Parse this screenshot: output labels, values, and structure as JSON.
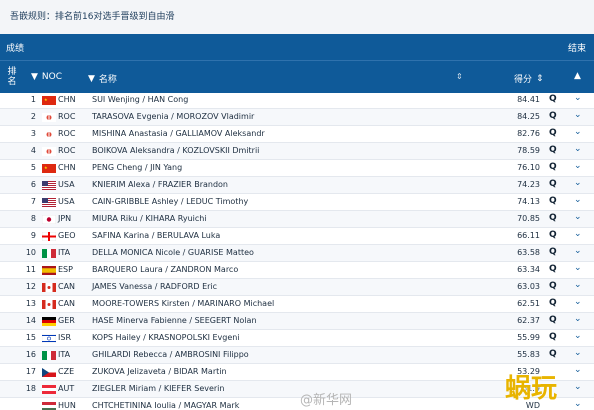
{
  "note": "吾嵌规则：排名前16对选手晋级到自由滑",
  "panel": {
    "title": "成绩",
    "close_label": "结束"
  },
  "header": {
    "rank": "排名",
    "noc": "NOC",
    "name": "名称",
    "score": "得分"
  },
  "rows": [
    {
      "rank": "1",
      "noc": "CHN",
      "pair": "SUI Wenjing / HAN Cong",
      "score": "84.41",
      "info": "Q"
    },
    {
      "rank": "2",
      "noc": "ROC",
      "pair": "TARASOVA Evgenia / MOROZOV Vladimir",
      "score": "84.25",
      "info": "Q"
    },
    {
      "rank": "3",
      "noc": "ROC",
      "pair": "MISHINA Anastasia / GALLIAMOV Aleksandr",
      "score": "82.76",
      "info": "Q"
    },
    {
      "rank": "4",
      "noc": "ROC",
      "pair": "BOIKOVA Aleksandra / KOZLOVSKII Dmitrii",
      "score": "78.59",
      "info": "Q"
    },
    {
      "rank": "5",
      "noc": "CHN",
      "pair": "PENG Cheng / JIN Yang",
      "score": "76.10",
      "info": "Q"
    },
    {
      "rank": "6",
      "noc": "USA",
      "pair": "KNIERIM Alexa / FRAZIER Brandon",
      "score": "74.23",
      "info": "Q"
    },
    {
      "rank": "7",
      "noc": "USA",
      "pair": "CAIN-GRIBBLE Ashley / LEDUC Timothy",
      "score": "74.13",
      "info": "Q"
    },
    {
      "rank": "8",
      "noc": "JPN",
      "pair": "MIURA Riku / KIHARA Ryuichi",
      "score": "70.85",
      "info": "Q"
    },
    {
      "rank": "9",
      "noc": "GEO",
      "pair": "SAFINA Karina / BERULAVA Luka",
      "score": "66.11",
      "info": "Q"
    },
    {
      "rank": "10",
      "noc": "ITA",
      "pair": "DELLA MONICA Nicole / GUARISE Matteo",
      "score": "63.58",
      "info": "Q"
    },
    {
      "rank": "11",
      "noc": "ESP",
      "pair": "BARQUERO Laura / ZANDRON Marco",
      "score": "63.34",
      "info": "Q"
    },
    {
      "rank": "12",
      "noc": "CAN",
      "pair": "JAMES Vanessa / RADFORD Eric",
      "score": "63.03",
      "info": "Q"
    },
    {
      "rank": "13",
      "noc": "CAN",
      "pair": "MOORE-TOWERS Kirsten / MARINARO Michael",
      "score": "62.51",
      "info": "Q"
    },
    {
      "rank": "14",
      "noc": "GER",
      "pair": "HASE Minerva Fabienne / SEEGERT Nolan",
      "score": "62.37",
      "info": "Q"
    },
    {
      "rank": "15",
      "noc": "ISR",
      "pair": "KOPS Hailey / KRASNOPOLSKI Evgeni",
      "score": "55.99",
      "info": "Q"
    },
    {
      "rank": "16",
      "noc": "ITA",
      "pair": "GHILARDI Rebecca / AMBROSINI Filippo",
      "score": "55.83",
      "info": "Q"
    },
    {
      "rank": "17",
      "noc": "CZE",
      "pair": "ZUKOVA Jelizaveta / BIDAR Martin",
      "score": "53.29",
      "info": ""
    },
    {
      "rank": "18",
      "noc": "AUT",
      "pair": "ZIEGLER Miriam / KIEFER Severin",
      "score": "51.9",
      "info": ""
    },
    {
      "rank": "",
      "noc": "HUN",
      "pair": "CHTCHETININA Ioulia / MAGYAR Mark",
      "score": "WD",
      "info": ""
    }
  ],
  "watermark": "@新华网",
  "logo": "蜗玩"
}
